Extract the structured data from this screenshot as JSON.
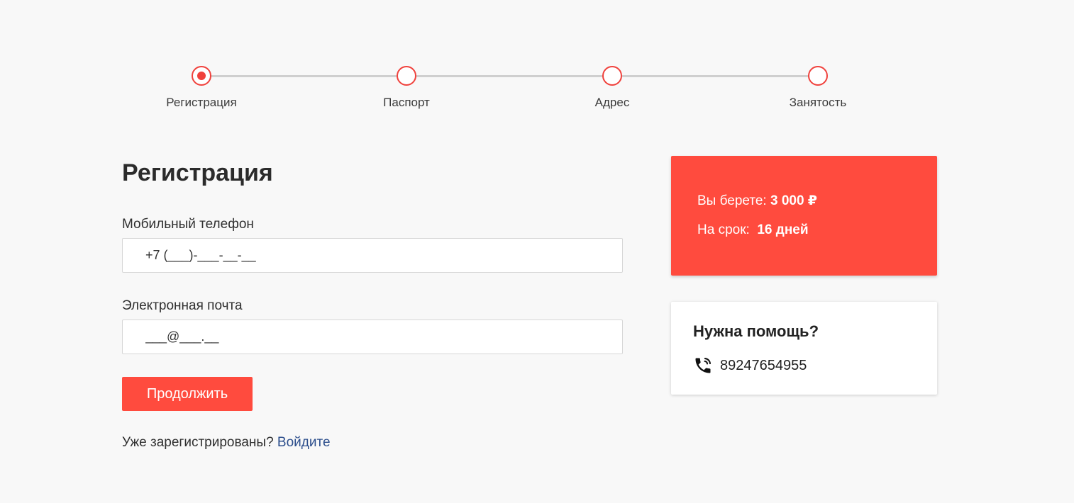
{
  "stepper": {
    "steps": [
      {
        "label": "Регистрация",
        "active": true
      },
      {
        "label": "Паспорт",
        "active": false
      },
      {
        "label": "Адрес",
        "active": false
      },
      {
        "label": "Занятость",
        "active": false
      }
    ]
  },
  "form": {
    "title": "Регистрация",
    "phone": {
      "label": "Мобильный телефон",
      "value": "+7 (___)-___-__-__"
    },
    "email": {
      "label": "Электронная почта",
      "value": "___@___.__"
    },
    "continue_label": "Продолжить",
    "login_prompt": "Уже зарегистрированы?",
    "login_link": "Войдите"
  },
  "loan": {
    "amount_label": "Вы берете:",
    "amount_value": "3 000 ₽",
    "term_label": "На срок:",
    "term_value": "16 дней"
  },
  "help": {
    "title": "Нужна помощь?",
    "phone": "89247654955",
    "icon": "phone-icon"
  },
  "colors": {
    "accent": "#ff4b3e",
    "link": "#2c4e8c"
  }
}
